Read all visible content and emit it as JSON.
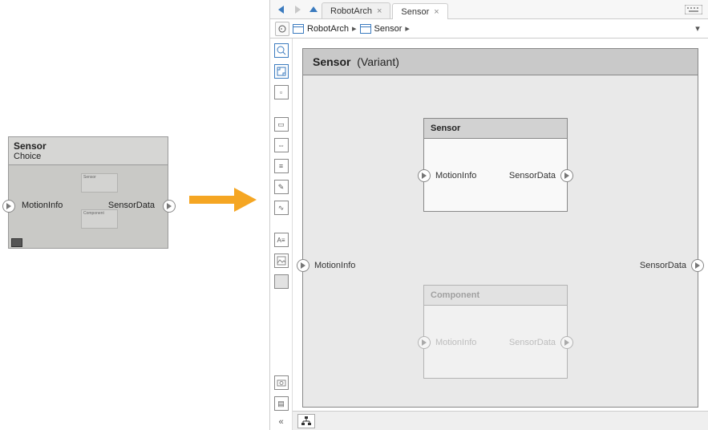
{
  "small_block": {
    "title": "Sensor",
    "subtitle": "Choice",
    "port_in": "MotionInfo",
    "port_out": "SensorData",
    "tiny1": "Sensor",
    "tiny2": "Component"
  },
  "tabs": {
    "tab1": "RobotArch",
    "tab2": "Sensor"
  },
  "breadcrumb": {
    "item1": "RobotArch",
    "item2": "Sensor"
  },
  "canvas": {
    "title_name": "Sensor",
    "title_qualifier": "(Variant)",
    "port_in": "MotionInfo",
    "port_out": "SensorData"
  },
  "inner_block_1": {
    "title": "Sensor",
    "port_in": "MotionInfo",
    "port_out": "SensorData"
  },
  "inner_block_2": {
    "title": "Component",
    "port_in": "MotionInfo",
    "port_out": "SensorData"
  }
}
